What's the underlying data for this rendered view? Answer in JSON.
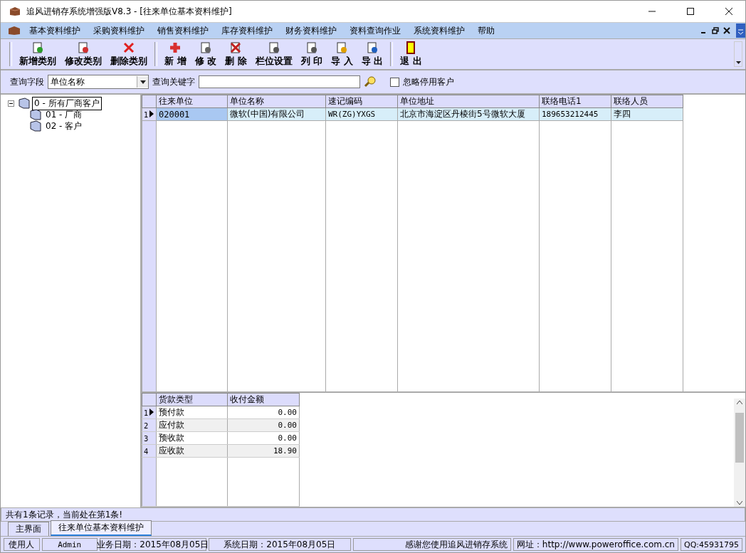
{
  "window": {
    "title": "追风进销存系统增强版V8.3 - [往来单位基本资料维护]"
  },
  "menu": [
    "基本资料维护",
    "采购资料维护",
    "销售资料维护",
    "库存资料维护",
    "财务资料维护",
    "资料查询作业",
    "系统资料维护",
    "帮助"
  ],
  "toolbar": [
    [
      "新增类别",
      "修改类别",
      "删除类别"
    ],
    [
      "新 增",
      "修 改",
      "删 除",
      "栏位设置",
      "列 印",
      "导 入",
      "导 出"
    ],
    [
      "退 出"
    ]
  ],
  "search": {
    "field_label": "查询字段",
    "field_value": "单位名称",
    "keyword_label": "查询关键字",
    "ignore_disabled": {
      "label": "忽略停用客户",
      "checked": false
    }
  },
  "tree": [
    {
      "label": "0 - 所有厂商客户",
      "selected": true,
      "expanded": true,
      "children": [
        {
          "label": "01 - 厂商",
          "selected": false
        },
        {
          "label": "02 - 客户",
          "selected": false
        }
      ]
    }
  ],
  "table": {
    "columns": [
      "往来单位",
      "单位名称",
      "速记编码",
      "单位地址",
      "联络电话1",
      "联络人员"
    ],
    "rows": [
      {
        "index": "1",
        "selected": true,
        "cells": [
          "020001",
          "微软(中国)有限公司",
          "WR(ZG)YXGS",
          "北京市海淀区丹棱街5号微软大厦",
          "189653212445",
          "李四"
        ]
      }
    ]
  },
  "payments": {
    "columns": [
      "货款类型",
      "收付金额"
    ],
    "rows": [
      {
        "index": "1",
        "selected": true,
        "cells": [
          "预付款",
          "0.00"
        ]
      },
      {
        "index": "2",
        "selected": false,
        "cells": [
          "应付款",
          "0.00"
        ]
      },
      {
        "index": "3",
        "selected": false,
        "cells": [
          "预收款",
          "0.00"
        ]
      },
      {
        "index": "4",
        "selected": false,
        "cells": [
          "应收款",
          "18.90"
        ]
      }
    ]
  },
  "record_status": "共有1条记录，当前处在第1条!",
  "tabs": [
    {
      "label": "主界面",
      "selected": false
    },
    {
      "label": "往来单位基本资料维护",
      "selected": true
    }
  ],
  "status_bar": [
    "使用人",
    "Admin",
    "业务日期：2015年08月05日",
    "系统日期：2015年08月05日",
    "感谢您使用追风进销存系统",
    "网址：http://www.poweroffice.com.cn",
    "QQ:45931795"
  ]
}
